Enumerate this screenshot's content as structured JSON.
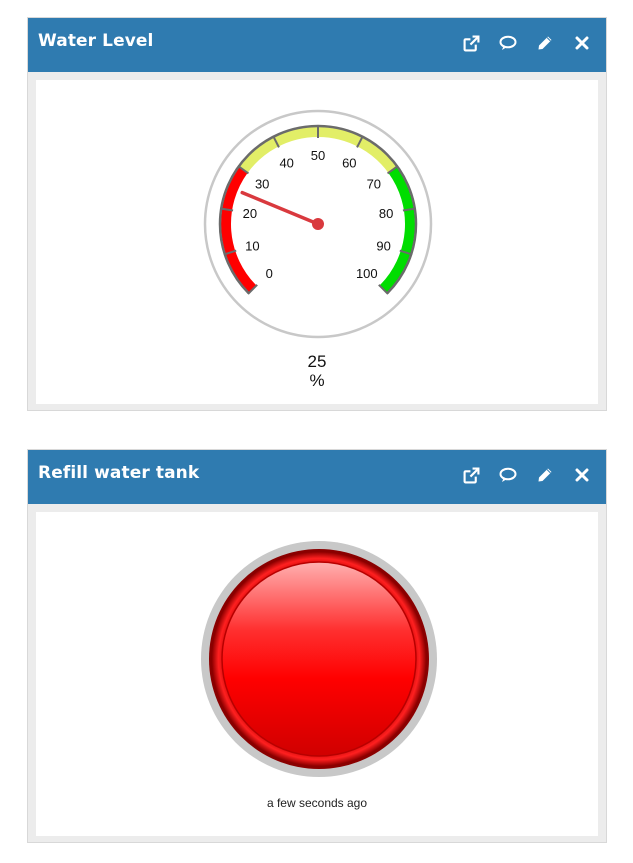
{
  "panels": [
    {
      "title": "Water Level",
      "gauge": {
        "value": 25,
        "value_label": "25",
        "unit": "%",
        "min": 0,
        "max": 100,
        "ticks": [
          "0",
          "10",
          "20",
          "30",
          "40",
          "50",
          "60",
          "70",
          "80",
          "90",
          "100"
        ],
        "bands": [
          {
            "from": 0,
            "to": 30,
            "color": "#ff0000"
          },
          {
            "from": 30,
            "to": 70,
            "color": "#e2ee67"
          },
          {
            "from": 70,
            "to": 100,
            "color": "#00dd00"
          }
        ],
        "needle_color": "#d9393e"
      }
    },
    {
      "title": "Refill water tank",
      "button": {
        "color": "#ff0000",
        "state": "on"
      },
      "timestamp": "a few seconds ago"
    }
  ],
  "toolbar_icons": [
    "external-link-icon",
    "comment-icon",
    "edit-pencil-icon",
    "close-icon"
  ]
}
